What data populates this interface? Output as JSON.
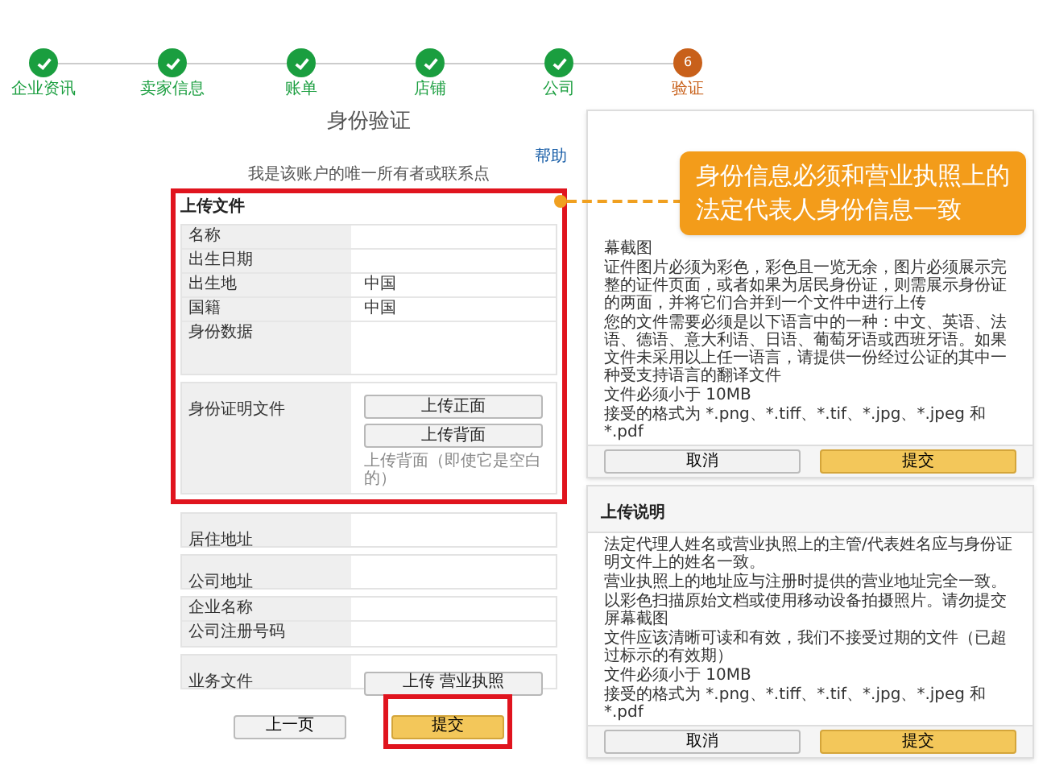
{
  "steps": [
    {
      "label": "企业资讯",
      "completed": true
    },
    {
      "label": "卖家信息",
      "completed": true
    },
    {
      "label": "账单",
      "completed": true
    },
    {
      "label": "店铺",
      "completed": true
    },
    {
      "label": "公司",
      "completed": true
    },
    {
      "label": "验证",
      "completed": false,
      "number": "6"
    }
  ],
  "title": "身份验证",
  "help_link": "帮助",
  "owner_note": "我是该账户的唯一所有者或联系点",
  "upload_section": {
    "title": "上传文件",
    "highlighted": true,
    "fields": [
      {
        "label": "名称",
        "kind": "line"
      },
      {
        "label": "出生日期",
        "kind": "line"
      },
      {
        "label": "出生地",
        "value": "中国",
        "kind": "line"
      },
      {
        "label": "国籍",
        "value": "中国",
        "kind": "line"
      },
      {
        "label": "身份数据",
        "kind": "tall"
      }
    ],
    "id_document": {
      "label": "身份证明文件",
      "buttons": [
        "上传正面",
        "上传背面"
      ],
      "note": "上传背面（即使它是空白的）"
    }
  },
  "address_fields": [
    {
      "label": "居住地址"
    },
    {
      "label": "公司地址"
    }
  ],
  "company_fields": [
    {
      "label": "企业名称"
    },
    {
      "label": "公司注册号码"
    }
  ],
  "business_document": {
    "label": "业务文件",
    "button": "上传 营业执照"
  },
  "nav_buttons": [
    {
      "label": "上一页",
      "kind": "secondary",
      "highlighted": false
    },
    {
      "label": "提交",
      "kind": "primary",
      "highlighted": true
    }
  ],
  "callout": {
    "lines": [
      "身份信息必须和营业执照上的",
      "法定代表人身份信息一致"
    ]
  },
  "info_panels": [
    {
      "bullets": [
        "幕截图",
        "证件图片必须为彩色，彩色且一览无余，图片必须展示完整的证件页面，或者如果为居民身份证，则需展示身份证的两面，并将它们合并到一个文件中进行上传",
        "您的文件需要必须是以下语言中的一种：中文、英语、法语、德语、意大利语、日语、葡萄牙语或西班牙语。如果文件未采用以上任一语言，请提供一份经过公证的其中一种受支持语言的翻译文件",
        "文件必须小于 10MB",
        "接受的格式为 *.png、*.tiff、*.tif、*.jpg、*.jpeg 和 *.pdf"
      ],
      "buttons": [
        "取消",
        "提交"
      ]
    },
    {
      "title": "上传说明",
      "bullets": [
        "法定代理人姓名或营业执照上的主管/代表姓名应与身份证明文件上的姓名一致。",
        "营业执照上的地址应与注册时提供的营业地址完全一致。",
        "以彩色扫描原始文档或使用移动设备拍摄照片。请勿提交屏幕截图",
        "文件应该清晰可读和有效，我们不接受过期的文件（已超过标示的有效期）",
        "文件必须小于 10MB",
        "接受的格式为 *.png、*.tiff、*.tif、*.jpg、*.jpeg 和 *.pdf"
      ],
      "buttons": [
        "取消",
        "提交"
      ]
    }
  ]
}
